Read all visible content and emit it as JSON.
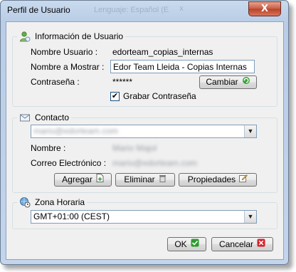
{
  "window": {
    "title": "Perfil de Usuario",
    "close_glyph": "X",
    "behind_text": "Lenguaje: Español (E",
    "behind_close": "x"
  },
  "user_info": {
    "section_title": "Información de Usuario",
    "username_label": "Nombre Usuario :",
    "username_value": "edorteam_copias_internas",
    "display_name_label": "Nombre a Mostrar :",
    "display_name_value": "Edor Team Lleida - Copias Internas",
    "password_label": "Contraseña :",
    "password_value": "******",
    "change_button": "Cambiar",
    "save_password_label": "Grabar Contraseña",
    "save_password_checked": true
  },
  "contact": {
    "section_title": "Contacto",
    "selected_contact": "mario@edorteam.com",
    "name_label": "Nombre :",
    "name_value": "Mario Majol",
    "email_label": "Correo Electrónico :",
    "email_value": "mario@edorteam.com",
    "add_button": "Agregar",
    "delete_button": "Eliminar",
    "properties_button": "Propiedades"
  },
  "timezone": {
    "section_title": "Zona Horaria",
    "selected": "GMT+01:00 (CEST)"
  },
  "footer": {
    "ok_button": "OK",
    "cancel_button": "Cancelar"
  },
  "colors": {
    "accent_green": "#2e9a2e",
    "cancel_red": "#d4212a",
    "frame_blue": "#c3d5ec"
  }
}
